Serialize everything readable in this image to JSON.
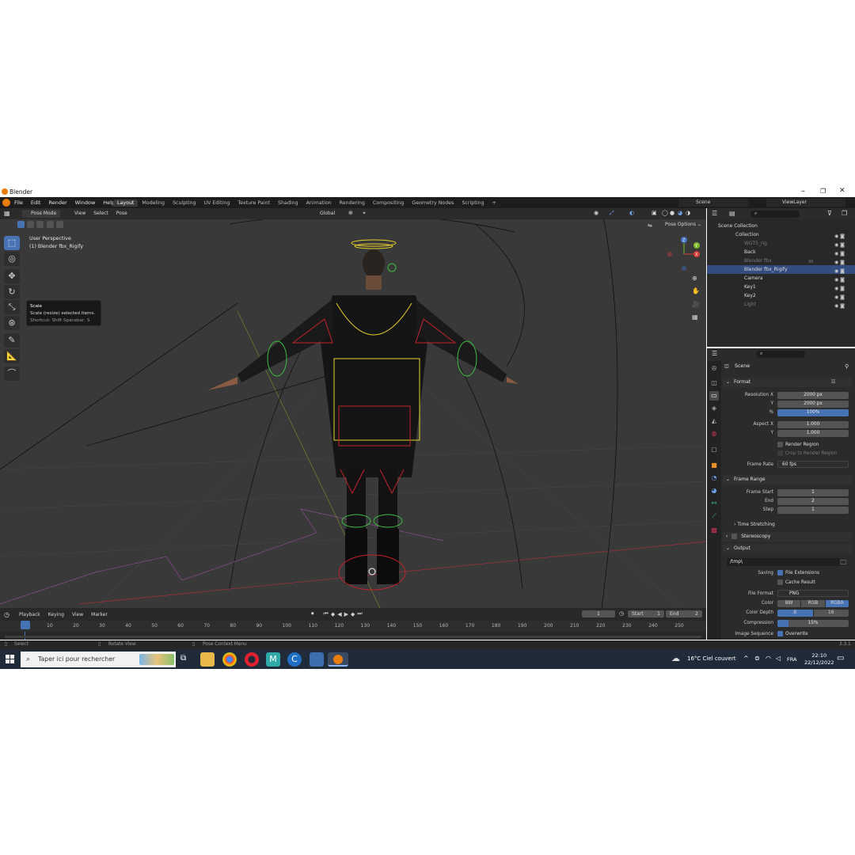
{
  "window": {
    "title": "Blender"
  },
  "menu": [
    "File",
    "Edit",
    "Render",
    "Window",
    "Help"
  ],
  "workspaces": [
    "Layout",
    "Modeling",
    "Sculpting",
    "UV Editing",
    "Texture Paint",
    "Shading",
    "Animation",
    "Rendering",
    "Compositing",
    "Geometry Nodes",
    "Scripting"
  ],
  "active_workspace": "Layout",
  "scene_field": "Scene",
  "viewlayer_field": "ViewLayer",
  "viewport": {
    "mode": "Pose Mode",
    "header_menus": [
      "View",
      "Select",
      "Pose"
    ],
    "orientation": "Global",
    "pose_options": "Pose Options",
    "perspective": "User Perspective",
    "active_object": "(1) Blender fbx_Rigify",
    "gizmo_axes": [
      "X",
      "Y",
      "Z"
    ]
  },
  "tooltip": {
    "title": "Scale",
    "desc": "Scale (resize) selected items.",
    "shortcut": "Shortcut: Shift Spacebar, S"
  },
  "outliner": {
    "root": "Scene Collection",
    "items": [
      {
        "label": "Collection",
        "dim": false
      },
      {
        "label": "WGTS_rig",
        "dim": true
      },
      {
        "label": "Back",
        "dim": false
      },
      {
        "label": "Blender fbx",
        "dim": true
      },
      {
        "label": "Blender fbx_Rigify",
        "dim": false,
        "selected": true
      },
      {
        "label": "Camera",
        "dim": false
      },
      {
        "label": "Key1",
        "dim": false
      },
      {
        "label": "Key2",
        "dim": false
      },
      {
        "label": "Light",
        "dim": true
      }
    ],
    "badge": "99"
  },
  "properties": {
    "context": "Scene",
    "format": {
      "header": "Format",
      "res_x_label": "Resolution X",
      "res_x": "2000 px",
      "res_y_label": "Y",
      "res_y": "2000 px",
      "pct_label": "%",
      "pct": "100%",
      "aspect_x_label": "Aspect X",
      "aspect_x": "1.000",
      "aspect_y_label": "Y",
      "aspect_y": "1.000",
      "render_region": "Render Region",
      "crop_region": "Crop to Render Region",
      "frame_rate_label": "Frame Rate",
      "frame_rate": "60 fps"
    },
    "frame_range": {
      "header": "Frame Range",
      "start_label": "Frame Start",
      "start": "1",
      "end_label": "End",
      "end": "2",
      "step_label": "Step",
      "step": "1",
      "time_stretching": "Time Stretching"
    },
    "stereoscopy": "Stereoscopy",
    "output": {
      "header": "Output",
      "path": "/tmp\\",
      "saving_label": "Saving",
      "file_ext": "File Extensions",
      "cache_result": "Cache Result",
      "file_format_label": "File Format",
      "file_format": "PNG",
      "color_label": "Color",
      "color_options": [
        "BW",
        "RGB",
        "RGBA"
      ],
      "color_selected": "RGBA",
      "depth_label": "Color Depth",
      "depth_options": [
        "8",
        "16"
      ],
      "depth_selected": "8",
      "compression_label": "Compression",
      "compression": "15%",
      "compression_value": 0.15,
      "image_seq_label": "Image Sequence",
      "overwrite": "Overwrite"
    }
  },
  "timeline": {
    "menus": [
      "Playback",
      "Keying",
      "View",
      "Marker"
    ],
    "current_frame": "1",
    "start_label": "Start",
    "start": "1",
    "end_label": "End",
    "end": "2",
    "ticks": [
      "1",
      "10",
      "20",
      "30",
      "40",
      "50",
      "60",
      "70",
      "80",
      "90",
      "100",
      "110",
      "120",
      "130",
      "140",
      "150",
      "160",
      "170",
      "180",
      "190",
      "200",
      "210",
      "220",
      "230",
      "240",
      "250"
    ]
  },
  "statusbar": {
    "select": "Select",
    "rotate": "Rotate View",
    "context": "Pose Context Menu",
    "version": "3.3.1"
  },
  "taskbar": {
    "search_placeholder": "Taper ici pour rechercher",
    "weather": "16°C  Ciel couvert",
    "lang": "FRA",
    "time": "22:10",
    "date": "22/12/2022"
  },
  "colors": {
    "accent": "#4772b3",
    "selection": "#334d80",
    "rig_yellow": "#e8d22a",
    "rig_red": "#c0232a",
    "rig_green": "#3dbf3d",
    "x_axis": "#d33b3b",
    "y_axis": "#7dbb2d"
  }
}
